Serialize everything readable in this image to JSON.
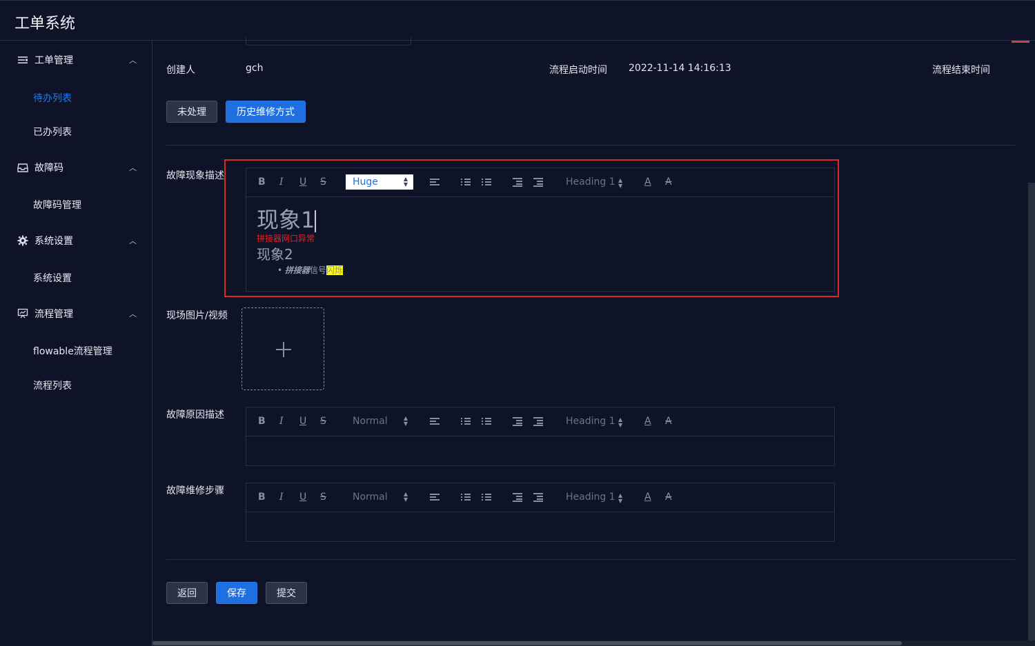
{
  "app": {
    "title": "工单系统"
  },
  "sidebar": {
    "groups": [
      {
        "label": "工单管理",
        "icon": "list-icon",
        "items": [
          "待办列表",
          "已办列表"
        ]
      },
      {
        "label": "故障码",
        "icon": "inbox-icon",
        "items": [
          "故障码管理"
        ]
      },
      {
        "label": "系统设置",
        "icon": "gear-icon",
        "items": [
          "系统设置"
        ]
      },
      {
        "label": "流程管理",
        "icon": "presentation-icon",
        "items": [
          "flowable流程管理",
          "流程列表"
        ]
      }
    ],
    "active_item": "待办列表"
  },
  "info": {
    "creator_label": "创建人",
    "creator_value": "gch",
    "start_label": "流程启动时间",
    "start_value": "2022-11-14 14:16:13",
    "end_label": "流程结束时间"
  },
  "tabs": {
    "unprocessed": "未处理",
    "history": "历史维修方式"
  },
  "form": {
    "phenomenon_label": "故障现象描述",
    "media_label": "现场图片/视频",
    "cause_label": "故障原因描述",
    "steps_label": "故障维修步骤"
  },
  "toolbar": {
    "bold": "B",
    "italic": "I",
    "underline": "U",
    "strike": "S",
    "size_huge": "Huge",
    "size_normal": "Normal",
    "heading": "Heading 1",
    "color": "A",
    "background": "A"
  },
  "editor_content": {
    "line1": "现象1",
    "line2": "拼接器网口异常",
    "line3": "现象2",
    "bullet_bold": "拼接器",
    "bullet_text": "信号",
    "bullet_highlight": "闪烁"
  },
  "colors": {
    "accent": "#1f6fe0",
    "error": "#e0242a",
    "highlight": "#ffff00",
    "text_red": "#e0242a"
  },
  "actions": {
    "back": "返回",
    "save": "保存",
    "submit": "提交"
  }
}
